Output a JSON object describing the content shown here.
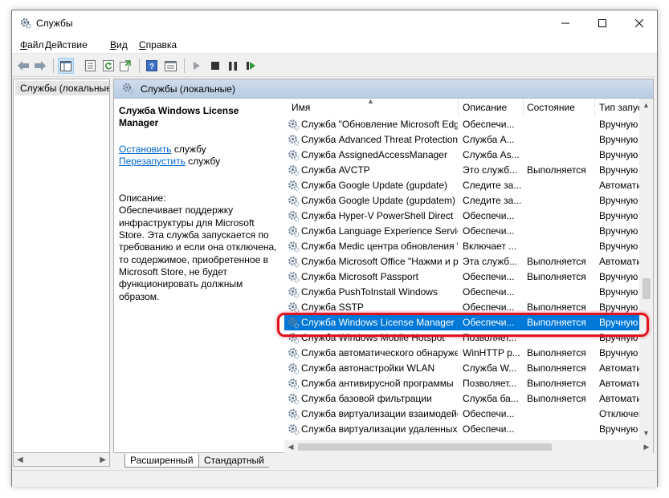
{
  "window": {
    "title": "Службы"
  },
  "menu": [
    {
      "label_u": "Ф",
      "label_rest": "айл"
    },
    {
      "label_u": "Д",
      "label_rest": "ействие"
    },
    {
      "label_u": "В",
      "label_rest": "ид"
    },
    {
      "label_u": "С",
      "label_rest": "правка"
    }
  ],
  "toolbar": {
    "icons": [
      "back-icon",
      "forward-icon",
      "show-hide-tree-icon",
      "properties-icon",
      "refresh-icon",
      "export-list-icon",
      "help-icon",
      "view-icon",
      "start-service-icon",
      "stop-service-icon",
      "pause-service-icon",
      "restart-service-icon"
    ]
  },
  "tree": {
    "item": "Службы (локальные)"
  },
  "pane": {
    "header": "Службы (локальные)"
  },
  "details": {
    "title": "Служба Windows License Manager",
    "stop_link": "Остановить",
    "stop_suffix": " службу",
    "restart_link": "Перезапустить",
    "restart_suffix": " службу",
    "desc_label": "Описание:",
    "desc_text": "Обеспечивает поддержку инфраструктуры для Microsoft Store. Эта служба запускается по требованию и если она отключена, то содержимое, приобретенное в Microsoft Store, не будет функционировать должным образом."
  },
  "columns": {
    "name": "Имя",
    "description": "Описание",
    "status": "Состояние",
    "startup": "Тип запус"
  },
  "rows": [
    {
      "name": "Служба \"Обновление Microsoft Edge\"",
      "desc": "Обеспечи...",
      "status": "",
      "startup": "Вручную"
    },
    {
      "name": "Служба Advanced Threat Protection",
      "desc": "Служба A...",
      "status": "",
      "startup": "Вручную"
    },
    {
      "name": "Служба AssignedAccessManager",
      "desc": "Служба As...",
      "status": "",
      "startup": "Вручную"
    },
    {
      "name": "Служба AVCTP",
      "desc": "Это служб...",
      "status": "Выполняется",
      "startup": "Вручную"
    },
    {
      "name": "Служба Google Update (gupdate)",
      "desc": "Следите за...",
      "status": "",
      "startup": "Автомати"
    },
    {
      "name": "Служба Google Update (gupdatem)",
      "desc": "Следите за...",
      "status": "",
      "startup": "Вручную"
    },
    {
      "name": "Служба Hyper-V PowerShell Direct",
      "desc": "Обеспечи...",
      "status": "",
      "startup": "Вручную"
    },
    {
      "name": "Служба Language Experience Service",
      "desc": "Обеспечи...",
      "status": "",
      "startup": "Вручную"
    },
    {
      "name": "Служба Medic центра обновления Windows",
      "desc": "Включает ...",
      "status": "",
      "startup": "Вручную"
    },
    {
      "name": "Служба Microsoft Office \"Нажми и работай\"",
      "desc": "Эта служб...",
      "status": "Выполняется",
      "startup": "Автомати"
    },
    {
      "name": "Служба Microsoft Passport",
      "desc": "Обеспечи...",
      "status": "Выполняется",
      "startup": "Вручную"
    },
    {
      "name": "Служба PushToInstall Windows",
      "desc": "Обеспечи...",
      "status": "",
      "startup": "Вручную"
    },
    {
      "name": "Служба SSTP",
      "desc": "Обеспечи...",
      "status": "Выполняется",
      "startup": "Вручную"
    },
    {
      "name": "Служба Windows License Manager",
      "desc": "Обеспечи...",
      "status": "Выполняется",
      "startup": "Вручную",
      "selected": true
    },
    {
      "name": "Служба Windows Mobile Hotspot",
      "desc": "Позволяет...",
      "status": "",
      "startup": "Вручную"
    },
    {
      "name": "Служба автоматического обнаружения",
      "desc": "WinHTTP р...",
      "status": "Выполняется",
      "startup": "Вручную"
    },
    {
      "name": "Служба автонастройки WLAN",
      "desc": "Служба W...",
      "status": "Выполняется",
      "startup": "Автомати"
    },
    {
      "name": "Служба антивирусной программы",
      "desc": "Позволяет...",
      "status": "Выполняется",
      "startup": "Автомати"
    },
    {
      "name": "Служба базовой фильтрации",
      "desc": "Служба ба...",
      "status": "Выполняется",
      "startup": "Автомати"
    },
    {
      "name": "Служба виртуализации взаимодействия",
      "desc": "Обеспечи...",
      "status": "",
      "startup": "Отключен"
    },
    {
      "name": "Служба виртуализации удаленных",
      "desc": "Обеспечи...",
      "status": "",
      "startup": "Вручную"
    }
  ],
  "tabs": {
    "extended": "Расширенный",
    "standard": "Стандартный"
  },
  "colors": {
    "selection": "#0078d7",
    "highlight": "#e0141e",
    "link": "#0066cc"
  }
}
